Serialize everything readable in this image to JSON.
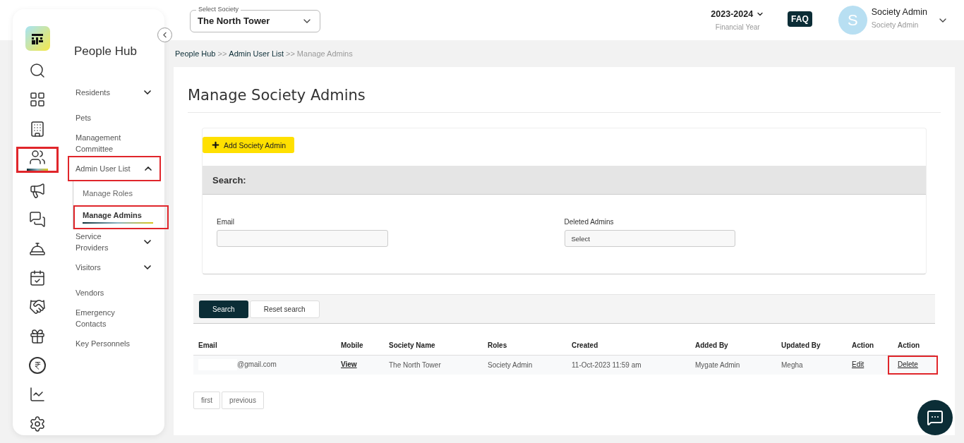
{
  "rail_items": [
    {
      "selected": false,
      "highlighted": false
    },
    {
      "selected": false,
      "highlighted": false
    },
    {
      "selected": false,
      "highlighted": false
    },
    {
      "selected": false,
      "highlighted": false
    },
    {
      "selected": true,
      "highlighted": true
    },
    {
      "selected": false,
      "highlighted": false
    },
    {
      "selected": false,
      "highlighted": false
    },
    {
      "selected": false,
      "highlighted": false
    },
    {
      "selected": false,
      "highlighted": false
    },
    {
      "selected": false,
      "highlighted": false
    },
    {
      "selected": false,
      "highlighted": false
    },
    {
      "selected": false,
      "highlighted": false
    },
    {
      "selected": false,
      "highlighted": false
    },
    {
      "selected": false,
      "highlighted": false
    }
  ],
  "menu": {
    "title": "People Hub",
    "items": [
      {
        "label": "Residents",
        "expandable": true,
        "expanded": false,
        "highlighted": false
      },
      {
        "label": "Pets",
        "expandable": false,
        "highlighted": false
      },
      {
        "label": "Management Committee",
        "expandable": false,
        "highlighted": false
      },
      {
        "label": "Admin User List",
        "expandable": true,
        "expanded": true,
        "highlighted": true,
        "children": [
          {
            "label": "Manage Roles",
            "selected": false,
            "highlighted": false
          },
          {
            "label": "Manage Admins",
            "selected": true,
            "highlighted": true
          }
        ]
      },
      {
        "label": "Service Providers",
        "expandable": true,
        "expanded": false,
        "highlighted": false
      },
      {
        "label": "Visitors",
        "expandable": true,
        "expanded": false,
        "highlighted": false
      },
      {
        "label": "Vendors",
        "expandable": false,
        "highlighted": false
      },
      {
        "label": "Emergency Contacts",
        "expandable": false,
        "highlighted": false
      },
      {
        "label": "Key Personnels",
        "expandable": false,
        "highlighted": false
      }
    ]
  },
  "header": {
    "society_select": {
      "label": "Select Society",
      "value": "The North Tower"
    },
    "year": {
      "value": "2023-2024",
      "caption": "Financial Year"
    },
    "faq": "FAQ",
    "user": {
      "initial": "S",
      "name": "Society Admin",
      "role": "Society Admin"
    }
  },
  "breadcrumb": [
    {
      "label": "People Hub",
      "current": false,
      "separator": ">>"
    },
    {
      "label": "Admin User List",
      "current": false,
      "separator": ">>"
    },
    {
      "label": "Manage Admins",
      "current": true
    }
  ],
  "title": "Manage Society Admins",
  "add_button": "Add Society Admin",
  "search": {
    "heading": "Search:",
    "fields": [
      {
        "label": "Email",
        "kind": "text"
      },
      {
        "label": "Deleted Admins",
        "kind": "select",
        "value": "Select"
      }
    ],
    "buttons": [
      {
        "label": "Search",
        "primary": true
      },
      {
        "label": "Reset search",
        "primary": false
      }
    ]
  },
  "table": {
    "columns": [
      "Email",
      "Mobile",
      "Society Name",
      "Roles",
      "Created",
      "Added By",
      "Updated By",
      "Action",
      "Action"
    ],
    "rows": [
      {
        "cells": [
          {
            "kind": "redacted",
            "text": "@gmail.com"
          },
          {
            "kind": "link",
            "text": "View",
            "highlighted": false
          },
          {
            "kind": "text",
            "text": "The North Tower"
          },
          {
            "kind": "text",
            "text": "Society Admin"
          },
          {
            "kind": "text",
            "text": "11-Oct-2023 11:59 am"
          },
          {
            "kind": "text",
            "text": "Mygate Admin"
          },
          {
            "kind": "text",
            "text": "Megha"
          },
          {
            "kind": "link",
            "text": "Edit",
            "highlighted": false
          },
          {
            "kind": "link",
            "text": "Delete",
            "highlighted": true
          }
        ]
      }
    ]
  },
  "pagination": [
    "first",
    "previous"
  ]
}
